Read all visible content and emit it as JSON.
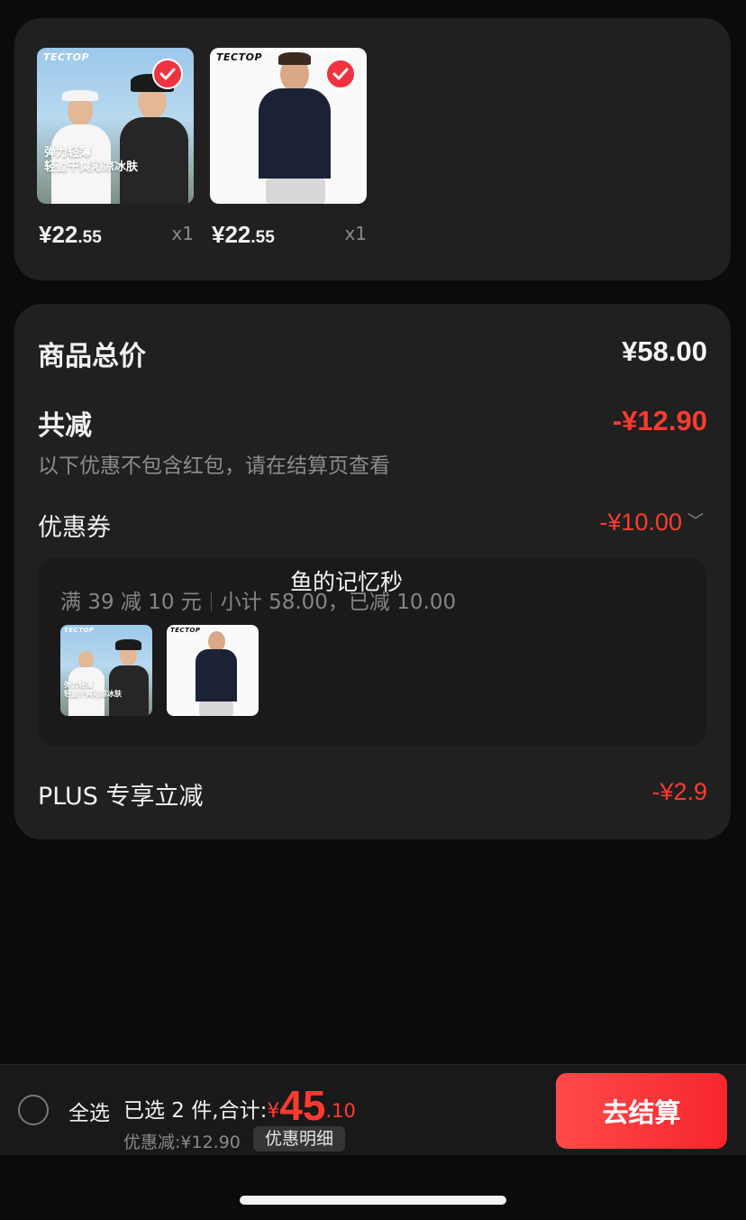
{
  "products": [
    {
      "brand": "TECTOP",
      "slogan_1": "弹力轻薄",
      "slogan_2": "轻盈干爽沁凉冰肤",
      "price_currency": "¥",
      "price_int": "22",
      "price_dec": ".55",
      "qty": "x1",
      "selected": true
    },
    {
      "brand": "TECTOP",
      "slogan_1": "",
      "slogan_2": "",
      "price_currency": "¥",
      "price_int": "22",
      "price_dec": ".55",
      "qty": "x1",
      "selected": true
    }
  ],
  "summary": {
    "total_label": "商品总价",
    "total_value": "¥58.00",
    "reduce_label": "共减",
    "reduce_value": "-¥12.90",
    "reduce_note": "以下优惠不包含红包，请在结算页查看",
    "coupon_label": "优惠券",
    "coupon_value": "-¥10.00",
    "coupon_rule": "满 39 减 10 元",
    "coupon_subtotal": "小计 58.00，已减 10.00",
    "plus_label": "PLUS 专享立减",
    "plus_value": "-¥2.9"
  },
  "watermark": "鱼的记忆秒",
  "bottom_bar": {
    "select_all": "全选",
    "selected_text": "已选 2 件,合计:",
    "currency": "¥",
    "total_int": "45",
    "total_dec": ".10",
    "discount_text": "优惠减:¥12.90",
    "detail_button": "优惠明细",
    "checkout_button": "去结算"
  },
  "colors": {
    "accent_red": "#ff3b2f",
    "checkout_gradient_start": "#ff4a4a",
    "checkout_gradient_end": "#f5262c",
    "card_bg": "#202020",
    "page_bg": "#0b0b0b"
  },
  "icons": [
    "check-icon",
    "chevron-down-icon",
    "radio-circle-icon"
  ]
}
